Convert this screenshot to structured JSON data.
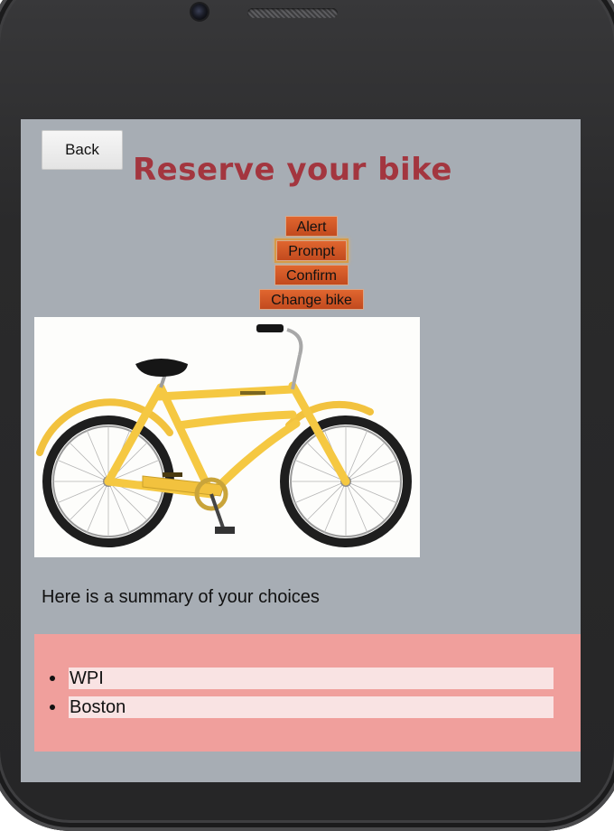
{
  "header": {
    "back_label": "Back",
    "title": "Reserve your bike"
  },
  "actions": [
    {
      "label": "Alert"
    },
    {
      "label": "Prompt"
    },
    {
      "label": "Confirm"
    },
    {
      "label": "Change bike"
    }
  ],
  "bike": {
    "icon": "bicycle-image"
  },
  "summary": {
    "heading": "Here is a summary of your choices",
    "choices": [
      "WPI",
      "Boston"
    ]
  },
  "colors": {
    "screen_background": "#a7adb4",
    "title": "#a3363f",
    "action_button": "#d2561f",
    "choices_panel": "#f09f9c",
    "choice_highlight": "#f9e3e3",
    "bike_frame": "#f5c842"
  }
}
